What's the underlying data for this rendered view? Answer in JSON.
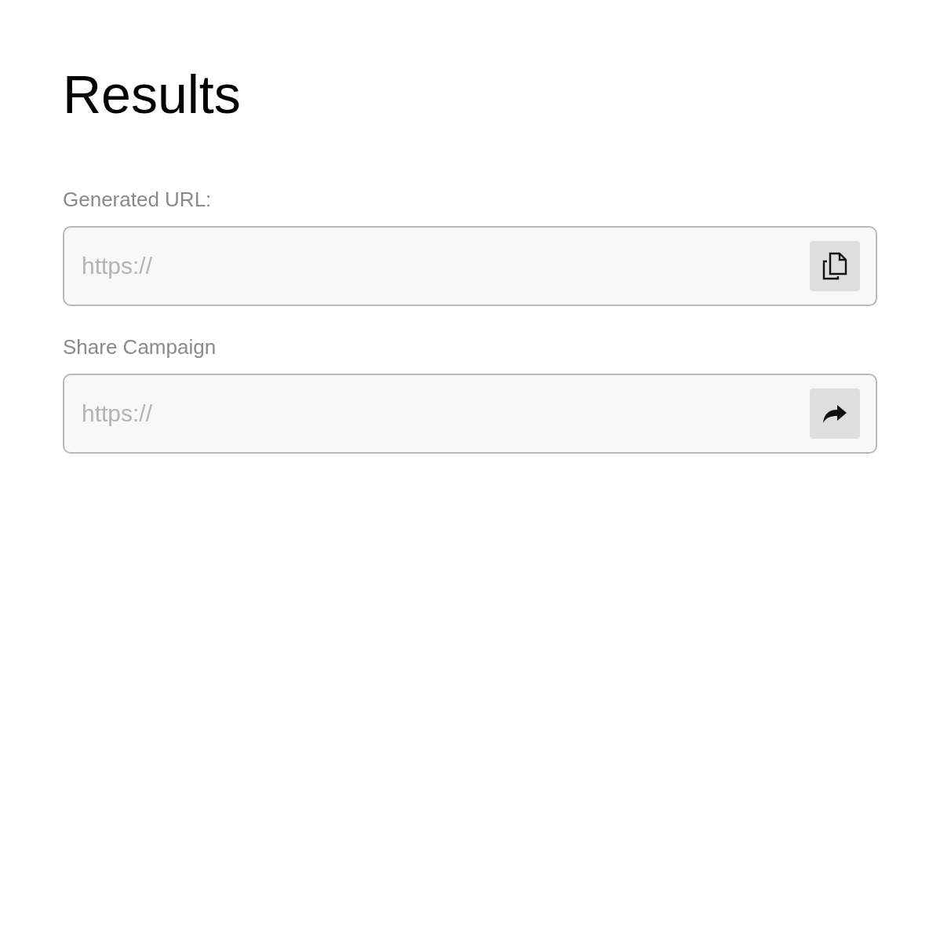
{
  "title": "Results",
  "fields": [
    {
      "label": "Generated URL:",
      "placeholder": "https://",
      "kind": "copy"
    },
    {
      "label": "Share Campaign",
      "placeholder": "https://",
      "kind": "share"
    }
  ]
}
